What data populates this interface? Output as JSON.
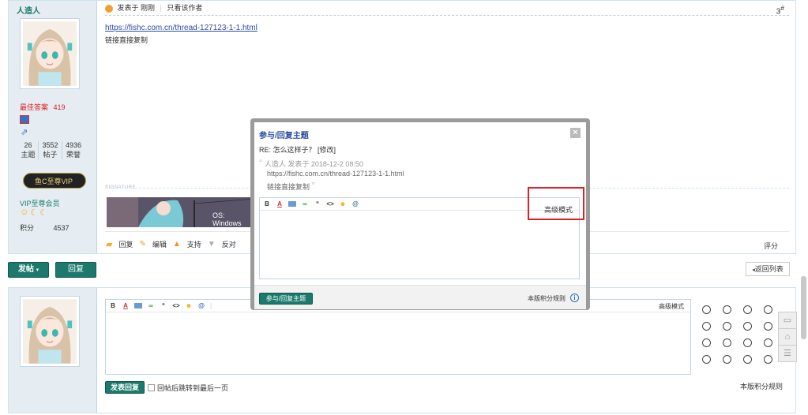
{
  "post": {
    "username": "人造人",
    "posted_icon": "clock-icon",
    "posted_at": "发表于 刚刚",
    "only_author": "只看该作者",
    "floor_no": "3",
    "floor_sup": "#",
    "link": "https://fishc.com.cn/thread-127123-1-1.html",
    "body_text": "链接直接复制",
    "best_answer_label": "最佳答案",
    "best_answer_count": "419",
    "stats": [
      {
        "value": "26",
        "label": "主题"
      },
      {
        "value": "3552",
        "label": "帖子"
      },
      {
        "value": "4936",
        "label": "荣誉"
      }
    ],
    "vip_badge": "鱼C至尊VIP",
    "vip_group": "VIP至尊会员",
    "points_label": "积分",
    "points_value": "4537",
    "signature_label": "SIGNATURE",
    "signature_text": "OS: Windows",
    "actions": {
      "reply": "回复",
      "edit": "编辑",
      "support": "支持",
      "oppose": "反对"
    },
    "rate": "评分"
  },
  "bar": {
    "post_button": "发帖",
    "reply_button": "回复",
    "back_list": "返回列表"
  },
  "quick_reply": {
    "advanced_mode": "高级模式",
    "submit": "发表回复",
    "jump_last": "回帖后跳转到最后一页",
    "rules": "本版积分规则"
  },
  "dialog": {
    "title": "参与/回复主题",
    "close": "×",
    "subject": "RE: 怎么这样子？ [修改]",
    "quote_head": "人造人 发表于 2018-12-2 08:50",
    "quote_link": "https://fishc.com.cn/thread-127123-1-1.html",
    "quote_text": "链接直接复制",
    "advanced_mode": "高级模式",
    "submit": "参与/回复主题",
    "rules": "本版积分规则"
  },
  "colors": {
    "accent_green": "#1c7a6c",
    "highlight_red": "#e0202a",
    "link_blue": "#2b4ea3",
    "side_bg": "#e5edf2"
  }
}
